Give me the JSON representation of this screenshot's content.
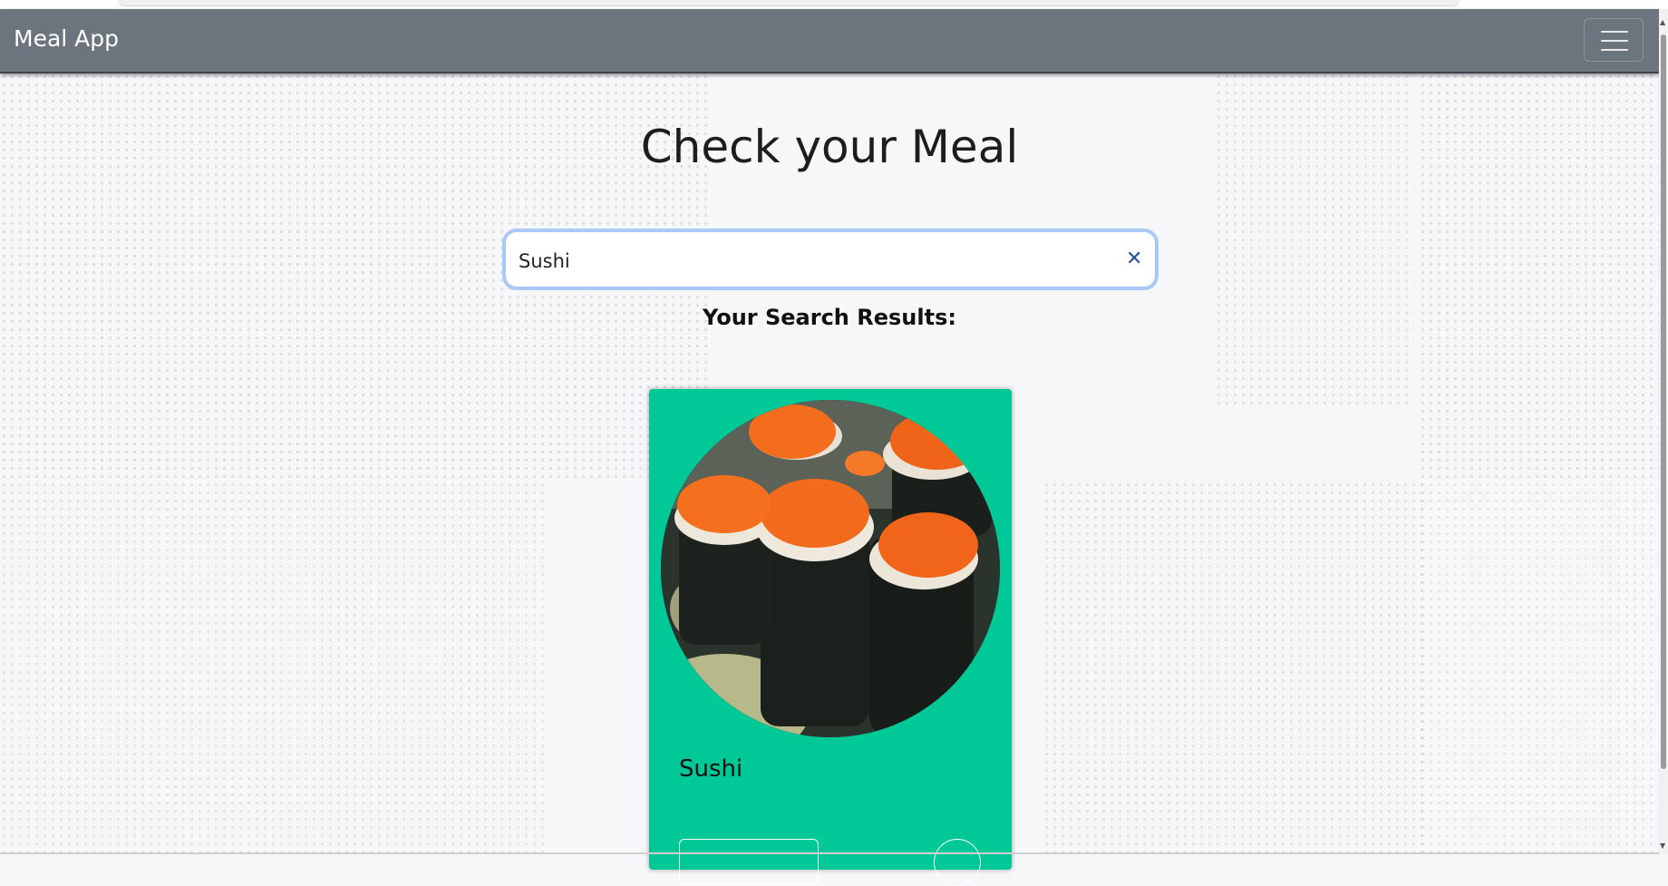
{
  "navbar": {
    "brand": "Meal App",
    "menu_icon": "hamburger-icon"
  },
  "main": {
    "title": "Check your Meal",
    "search": {
      "value": "Sushi",
      "placeholder": "",
      "clear_icon": "close-icon"
    },
    "results_heading": "Your Search Results:"
  },
  "results": [
    {
      "name": "Sushi",
      "image": "sushi-photo"
    }
  ],
  "colors": {
    "navbar": "#6c757d",
    "card": "#00c896",
    "background": "#f7f7f9",
    "search_focus": "#a9c8f5",
    "clear_icon": "#2b4f9c"
  }
}
